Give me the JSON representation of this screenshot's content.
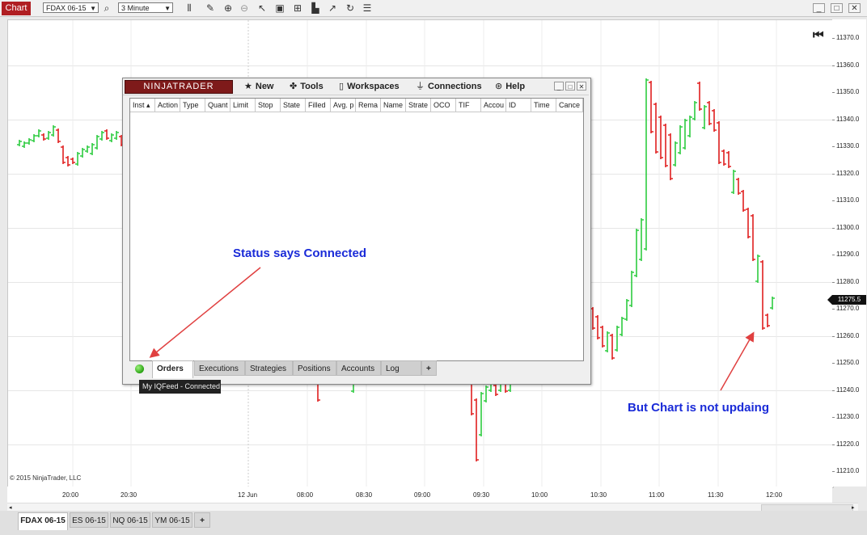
{
  "toolbar": {
    "chart_tab": "Chart",
    "instrument": "FDAX 06-15",
    "interval": "3 Minute",
    "icons": [
      "search-icon",
      "bars-icon",
      "pencil-icon",
      "zoom-in-icon",
      "zoom-out-icon",
      "pointer-icon",
      "properties-icon",
      "data-box-icon",
      "drawing-tools-icon",
      "refresh-icon",
      "list-icon"
    ],
    "window_controls": [
      "minimize",
      "maximize",
      "close"
    ]
  },
  "chart": {
    "price_labels": [
      "11370.0",
      "11360.0",
      "11350.0",
      "11340.0",
      "11330.0",
      "11320.0",
      "11310.0",
      "11300.0",
      "11290.0",
      "11280.0",
      "11270.0",
      "11260.0",
      "11250.0",
      "11240.0",
      "11230.0",
      "11220.0",
      "11210.0"
    ],
    "current_price": "11275.5",
    "time_labels": [
      "20:00",
      "20:30",
      "12 Jun",
      "08:00",
      "08:30",
      "09:00",
      "09:30",
      "10:00",
      "10:30",
      "11:00",
      "11:30",
      "12:00"
    ],
    "copyright": "© 2015 NinjaTrader, LLC",
    "colors": {
      "up": "#2ecc40",
      "down": "#e02020",
      "current_price_bg": "#111111"
    }
  },
  "bottom_tabs": [
    "FDAX 06-15",
    "ES 06-15",
    "NQ 06-15",
    "YM 06-15",
    "+"
  ],
  "nt_window": {
    "logo": "NINJATRADER",
    "menu": [
      {
        "icon": "star-icon",
        "label": "New"
      },
      {
        "icon": "tools-icon",
        "label": "Tools"
      },
      {
        "icon": "document-icon",
        "label": "Workspaces"
      },
      {
        "icon": "plug-icon",
        "label": "Connections"
      },
      {
        "icon": "lifebuoy-icon",
        "label": "Help"
      }
    ],
    "columns": [
      "Inst ▴",
      "Action",
      "Type",
      "Quant",
      "Limit",
      "Stop",
      "State",
      "Filled",
      "Avg. p",
      "Rema",
      "Name",
      "Strate",
      "OCO",
      "TIF",
      "Accou",
      "ID",
      "Time",
      "Cance"
    ],
    "tabs": [
      "Orders",
      "Executions",
      "Strategies",
      "Positions",
      "Accounts",
      "Log",
      "+"
    ],
    "tooltip": "My IQFeed - Connected"
  },
  "annotations": {
    "status": "Status says Connected",
    "chart": "But Chart is not updaing"
  }
}
